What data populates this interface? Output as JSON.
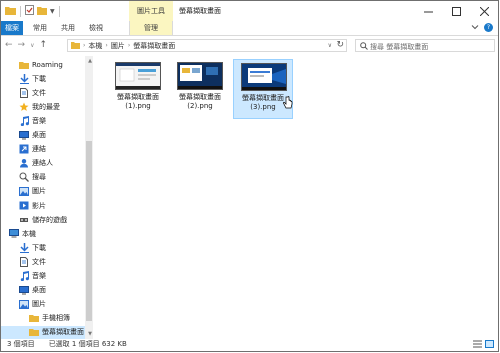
{
  "window": {
    "title": "螢幕擷取畫面",
    "context_group": "圖片工具"
  },
  "ribbon": {
    "tabs": [
      {
        "label": "檔案",
        "kind": "file"
      },
      {
        "label": "常用",
        "kind": "normal"
      },
      {
        "label": "共用",
        "kind": "normal"
      },
      {
        "label": "檢視",
        "kind": "normal"
      },
      {
        "label": "管理",
        "kind": "manage"
      }
    ]
  },
  "address": {
    "crumbs": [
      "本機",
      "圖片",
      "螢幕擷取畫面"
    ]
  },
  "search": {
    "placeholder": "搜尋 螢幕擷取畫面"
  },
  "sidebar": {
    "items": [
      {
        "label": "Roaming",
        "icon": "folder-icon",
        "indent": 2,
        "selected": false
      },
      {
        "label": "下載",
        "icon": "download-arrow-icon",
        "indent": 2,
        "selected": false
      },
      {
        "label": "文件",
        "icon": "document-icon",
        "indent": 2,
        "selected": false
      },
      {
        "label": "我的最愛",
        "icon": "star-icon",
        "indent": 2,
        "selected": false
      },
      {
        "label": "音樂",
        "icon": "music-icon",
        "indent": 2,
        "selected": false
      },
      {
        "label": "桌面",
        "icon": "desktop-icon",
        "indent": 2,
        "selected": false
      },
      {
        "label": "連結",
        "icon": "link-icon",
        "indent": 2,
        "selected": false
      },
      {
        "label": "連絡人",
        "icon": "contacts-icon",
        "indent": 2,
        "selected": false
      },
      {
        "label": "搜尋",
        "icon": "search-icon",
        "indent": 2,
        "selected": false
      },
      {
        "label": "圖片",
        "icon": "pictures-icon",
        "indent": 2,
        "selected": false
      },
      {
        "label": "影片",
        "icon": "video-icon",
        "indent": 2,
        "selected": false
      },
      {
        "label": "儲存的遊戲",
        "icon": "saved-games-icon",
        "indent": 2,
        "selected": false
      },
      {
        "label": "本機",
        "icon": "computer-icon",
        "indent": 1,
        "selected": false
      },
      {
        "label": "下載",
        "icon": "download-arrow-icon",
        "indent": 2,
        "selected": false
      },
      {
        "label": "文件",
        "icon": "document-icon",
        "indent": 2,
        "selected": false
      },
      {
        "label": "音樂",
        "icon": "music-icon",
        "indent": 2,
        "selected": false
      },
      {
        "label": "桌面",
        "icon": "desktop-icon",
        "indent": 2,
        "selected": false
      },
      {
        "label": "圖片",
        "icon": "pictures-icon",
        "indent": 2,
        "selected": false
      },
      {
        "label": "手機相簿",
        "icon": "folder-icon",
        "indent": 3,
        "selected": false
      },
      {
        "label": "螢幕擷取畫面",
        "icon": "folder-icon",
        "indent": 3,
        "selected": true
      }
    ]
  },
  "files": [
    {
      "name_line1": "螢幕擷取畫面",
      "name_line2": "(1).png",
      "selected": false
    },
    {
      "name_line1": "螢幕擷取畫面",
      "name_line2": "(2).png",
      "selected": false
    },
    {
      "name_line1": "螢幕擷取畫面",
      "name_line2": "(3).png",
      "selected": true
    }
  ],
  "status": {
    "count": "3 個項目",
    "selection": "已選取 1 個項目 632 KB"
  },
  "colors": {
    "accent": "#1979ca",
    "selection": "#cce8ff",
    "context_tab": "#fbf6c1",
    "folder": "#e8b63a"
  }
}
